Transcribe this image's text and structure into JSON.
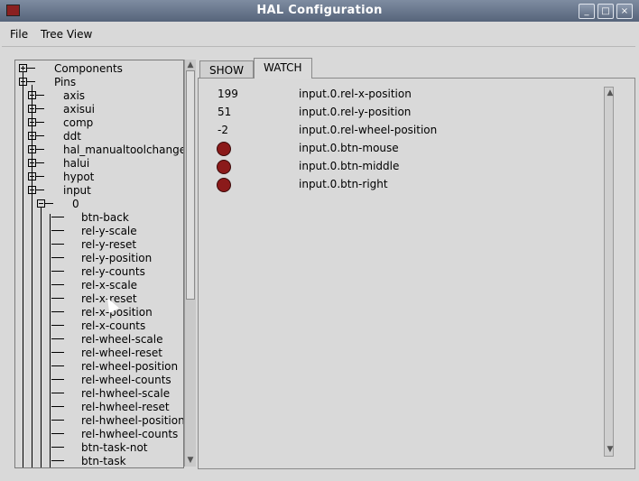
{
  "window": {
    "title": "HAL Configuration",
    "controls": [
      "_",
      "□",
      "×"
    ]
  },
  "menu": {
    "items": [
      "File",
      "Tree View"
    ]
  },
  "tree": {
    "nodes": [
      {
        "label": "Components",
        "level": 0,
        "expander": "plus"
      },
      {
        "label": "Pins",
        "level": 0,
        "expander": "minus"
      },
      {
        "label": "axis",
        "level": 1,
        "expander": "plus"
      },
      {
        "label": "axisui",
        "level": 1,
        "expander": "plus"
      },
      {
        "label": "comp",
        "level": 1,
        "expander": "plus"
      },
      {
        "label": "ddt",
        "level": 1,
        "expander": "plus"
      },
      {
        "label": "hal_manualtoolchange",
        "level": 1,
        "expander": "plus"
      },
      {
        "label": "halui",
        "level": 1,
        "expander": "plus"
      },
      {
        "label": "hypot",
        "level": 1,
        "expander": "plus"
      },
      {
        "label": "input",
        "level": 1,
        "expander": "minus"
      },
      {
        "label": "0",
        "level": 2,
        "expander": "minus"
      },
      {
        "label": "btn-back",
        "level": 3,
        "expander": "none"
      },
      {
        "label": "rel-y-scale",
        "level": 3,
        "expander": "none"
      },
      {
        "label": "rel-y-reset",
        "level": 3,
        "expander": "none"
      },
      {
        "label": "rel-y-position",
        "level": 3,
        "expander": "none"
      },
      {
        "label": "rel-y-counts",
        "level": 3,
        "expander": "none"
      },
      {
        "label": "rel-x-scale",
        "level": 3,
        "expander": "none"
      },
      {
        "label": "rel-x-reset",
        "level": 3,
        "expander": "none"
      },
      {
        "label": "rel-x-position",
        "level": 3,
        "expander": "none"
      },
      {
        "label": "rel-x-counts",
        "level": 3,
        "expander": "none"
      },
      {
        "label": "rel-wheel-scale",
        "level": 3,
        "expander": "none"
      },
      {
        "label": "rel-wheel-reset",
        "level": 3,
        "expander": "none"
      },
      {
        "label": "rel-wheel-position",
        "level": 3,
        "expander": "none"
      },
      {
        "label": "rel-wheel-counts",
        "level": 3,
        "expander": "none"
      },
      {
        "label": "rel-hwheel-scale",
        "level": 3,
        "expander": "none"
      },
      {
        "label": "rel-hwheel-reset",
        "level": 3,
        "expander": "none"
      },
      {
        "label": "rel-hwheel-position",
        "level": 3,
        "expander": "none"
      },
      {
        "label": "rel-hwheel-counts",
        "level": 3,
        "expander": "none"
      },
      {
        "label": "btn-task-not",
        "level": 3,
        "expander": "none"
      },
      {
        "label": "btn-task",
        "level": 3,
        "expander": "none"
      }
    ]
  },
  "tabs": [
    {
      "label": "SHOW",
      "active": false
    },
    {
      "label": "WATCH",
      "active": true
    }
  ],
  "watch": {
    "led_color": "#8b1a1a",
    "rows": [
      {
        "kind": "value",
        "value": "199",
        "name": "input.0.rel-x-position"
      },
      {
        "kind": "value",
        "value": "51",
        "name": "input.0.rel-y-position"
      },
      {
        "kind": "value",
        "value": "-2",
        "name": "input.0.rel-wheel-position"
      },
      {
        "kind": "led",
        "value": "",
        "name": "input.0.btn-mouse"
      },
      {
        "kind": "led",
        "value": "",
        "name": "input.0.btn-middle"
      },
      {
        "kind": "led",
        "value": "",
        "name": "input.0.btn-right"
      }
    ]
  }
}
